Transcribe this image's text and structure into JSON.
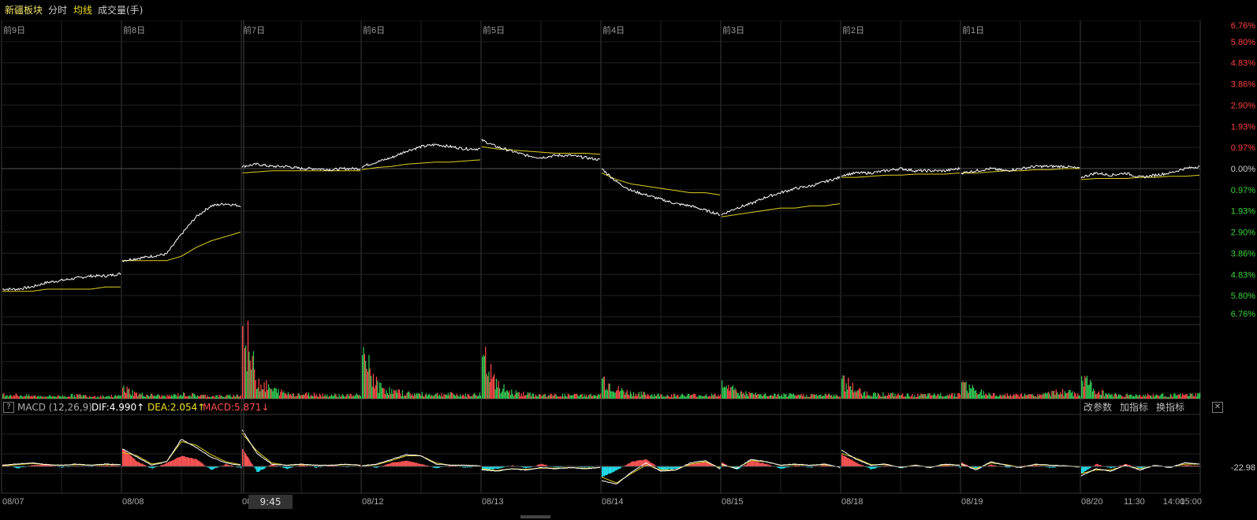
{
  "header": {
    "title": "新疆板块",
    "tab_intraday": "分时",
    "tab_avg": "均线",
    "tab_volume": "成交量(手)"
  },
  "price_axis": {
    "up_labels": [
      "6.76%",
      "5.80%",
      "4.83%",
      "3.86%",
      "2.90%",
      "1.93%",
      "0.97%"
    ],
    "zero_label": "0.00%",
    "down_labels": [
      "0.97%",
      "1.93%",
      "2.90%",
      "3.86%",
      "4.83%",
      "5.80%",
      "6.76%"
    ],
    "up_color": "#ff4040",
    "down_color": "#3cd43c"
  },
  "day_labels": [
    "前9日",
    "前8日",
    "前7日",
    "前6日",
    "前5日",
    "前4日",
    "前3日",
    "前2日",
    "前1日"
  ],
  "date_labels": [
    "08/07",
    "08/08",
    "08/08",
    "08/12",
    "08/13",
    "08/14",
    "08/15",
    "08/18",
    "08/19",
    "08/20"
  ],
  "time_labels": [
    "11:30",
    "14:00",
    "15:00"
  ],
  "crosshair_time": "9:45",
  "macd": {
    "help": "?",
    "name": "MACD (12,26,9)",
    "dif": "DIF:4.990↑",
    "dea": "DEA:2.054↑",
    "macd": "MACD:5.871↓",
    "value_right": "-22.98",
    "btn_params": "改参数",
    "btn_add": "加指标",
    "btn_switch": "换指标",
    "btn_close": "✕"
  },
  "colors": {
    "price_line": "#ffffff",
    "avg_line": "#e0d020",
    "dif": "#ffffff",
    "dea": "#e0d020",
    "up": "#ff5555",
    "down": "#22e0ee",
    "vol_up": "#ff4a4a",
    "vol_down": "#33cc55",
    "grid": "#2a2a2a"
  },
  "chart_data": {
    "type": "line",
    "days": 10,
    "price_pct": [
      [
        -5.5,
        -5.5,
        -5.4,
        -5.2,
        -5.1,
        -5.0,
        -4.9,
        -4.9,
        -4.8
      ],
      [
        -4.2,
        -4.1,
        -4.0,
        -3.9,
        -3.0,
        -2.2,
        -1.7,
        -1.6,
        -1.7
      ],
      [
        0.1,
        0.2,
        0.1,
        0.1,
        0.0,
        0.0,
        -0.05,
        0.0,
        0.0
      ],
      [
        0.1,
        0.3,
        0.5,
        0.8,
        1.0,
        1.1,
        1.0,
        0.9,
        0.9
      ],
      [
        1.3,
        1.0,
        0.8,
        0.6,
        0.5,
        0.6,
        0.6,
        0.5,
        0.4
      ],
      [
        0.0,
        -0.6,
        -1.0,
        -1.2,
        -1.4,
        -1.6,
        -1.7,
        -1.9,
        -2.1
      ],
      [
        -2.1,
        -1.8,
        -1.6,
        -1.3,
        -1.1,
        -0.9,
        -0.8,
        -0.6,
        -0.4
      ],
      [
        -0.3,
        -0.2,
        -0.2,
        -0.1,
        0.0,
        -0.1,
        -0.1,
        -0.1,
        0.0
      ],
      [
        -0.2,
        -0.1,
        0.0,
        -0.1,
        0.0,
        0.1,
        0.1,
        0.1,
        0.0
      ],
      [
        -0.4,
        -0.2,
        -0.3,
        -0.2,
        -0.4,
        -0.3,
        -0.2,
        0.0,
        0.1
      ]
    ],
    "avg_pct": [
      [
        -5.6,
        -5.6,
        -5.6,
        -5.5,
        -5.5,
        -5.5,
        -5.5,
        -5.4,
        -5.4
      ],
      [
        -4.2,
        -4.2,
        -4.2,
        -4.2,
        -4.0,
        -3.6,
        -3.3,
        -3.1,
        -2.9
      ],
      [
        -0.2,
        -0.15,
        -0.1,
        -0.1,
        -0.1,
        -0.1,
        -0.1,
        -0.1,
        -0.1
      ],
      [
        -0.05,
        0.05,
        0.1,
        0.2,
        0.25,
        0.3,
        0.3,
        0.35,
        0.4
      ],
      [
        1.0,
        0.9,
        0.85,
        0.8,
        0.75,
        0.7,
        0.7,
        0.7,
        0.65
      ],
      [
        -0.2,
        -0.5,
        -0.7,
        -0.8,
        -0.9,
        -1.0,
        -1.1,
        -1.1,
        -1.2
      ],
      [
        -2.2,
        -2.1,
        -2.0,
        -1.9,
        -1.8,
        -1.8,
        -1.7,
        -1.7,
        -1.6
      ],
      [
        -0.4,
        -0.4,
        -0.35,
        -0.3,
        -0.3,
        -0.25,
        -0.25,
        -0.25,
        -0.2
      ],
      [
        -0.2,
        -0.2,
        -0.15,
        -0.1,
        -0.1,
        -0.05,
        -0.05,
        0.0,
        0.0
      ],
      [
        -0.5,
        -0.45,
        -0.45,
        -0.45,
        -0.4,
        -0.4,
        -0.35,
        -0.35,
        -0.3
      ]
    ],
    "volume": [
      [
        5,
        4,
        3,
        3,
        3,
        4,
        3,
        3,
        3
      ],
      [
        12,
        5,
        4,
        3,
        5,
        4,
        3,
        3,
        4
      ],
      [
        80,
        20,
        10,
        6,
        5,
        5,
        4,
        4,
        4
      ],
      [
        48,
        15,
        8,
        6,
        5,
        5,
        5,
        4,
        5
      ],
      [
        46,
        14,
        7,
        5,
        4,
        4,
        4,
        4,
        4
      ],
      [
        22,
        10,
        6,
        5,
        4,
        4,
        4,
        4,
        4
      ],
      [
        20,
        8,
        5,
        4,
        4,
        4,
        4,
        4,
        4
      ],
      [
        22,
        9,
        5,
        5,
        4,
        4,
        4,
        5,
        5
      ],
      [
        18,
        8,
        5,
        4,
        4,
        4,
        6,
        8,
        4
      ],
      [
        25,
        8,
        5,
        4,
        4,
        4,
        4,
        4,
        5
      ]
    ],
    "macd_hist": [
      [
        4,
        -3,
        2,
        4,
        -2,
        1,
        -1,
        2,
        1
      ],
      [
        30,
        8,
        -4,
        6,
        18,
        12,
        -6,
        4,
        -3
      ],
      [
        30,
        -10,
        4,
        -4,
        3,
        -2,
        2,
        -1,
        1
      ],
      [
        2,
        -2,
        6,
        10,
        4,
        -3,
        2,
        -2,
        1
      ],
      [
        -6,
        -4,
        2,
        -3,
        4,
        -2,
        1,
        -2,
        1
      ],
      [
        -18,
        -6,
        8,
        12,
        -6,
        -4,
        4,
        8,
        -3
      ],
      [
        6,
        -6,
        10,
        4,
        -4,
        2,
        -2,
        3,
        -2
      ],
      [
        20,
        6,
        -5,
        2,
        -3,
        2,
        -2,
        3,
        -2
      ],
      [
        6,
        -4,
        3,
        -2,
        1,
        2,
        -2,
        1,
        -1
      ],
      [
        -12,
        4,
        -3,
        4,
        -3,
        2,
        -2,
        2,
        1
      ]
    ],
    "dif": [
      [
        2,
        4,
        6,
        3,
        2,
        4,
        2,
        4,
        3
      ],
      [
        30,
        16,
        2,
        8,
        46,
        32,
        16,
        6,
        2
      ],
      [
        62,
        22,
        4,
        2,
        4,
        2,
        2,
        4,
        2
      ],
      [
        1,
        4,
        12,
        20,
        18,
        4,
        2,
        2,
        1
      ],
      [
        -6,
        -8,
        -4,
        -6,
        -2,
        -4,
        -2,
        -4,
        -2
      ],
      [
        -24,
        -30,
        -10,
        6,
        -8,
        -6,
        6,
        10,
        -4
      ],
      [
        4,
        -4,
        12,
        8,
        2,
        4,
        2,
        4,
        -2
      ],
      [
        28,
        12,
        2,
        4,
        -2,
        2,
        -2,
        4,
        2
      ],
      [
        4,
        -6,
        8,
        2,
        -2,
        4,
        2,
        1,
        -1
      ],
      [
        -16,
        -4,
        -8,
        2,
        -6,
        2,
        -2,
        6,
        4
      ]
    ],
    "dea": [
      [
        1,
        3,
        5,
        3,
        2,
        3,
        2,
        3,
        3
      ],
      [
        24,
        18,
        4,
        8,
        42,
        36,
        20,
        8,
        3
      ],
      [
        56,
        26,
        6,
        2,
        3,
        2,
        2,
        3,
        2
      ],
      [
        1,
        3,
        10,
        18,
        18,
        6,
        2,
        2,
        1
      ],
      [
        -4,
        -7,
        -4,
        -5,
        -3,
        -3,
        -2,
        -3,
        -2
      ],
      [
        -18,
        -28,
        -12,
        2,
        -6,
        -6,
        4,
        8,
        -2
      ],
      [
        2,
        -3,
        10,
        8,
        2,
        3,
        2,
        3,
        -1
      ],
      [
        22,
        14,
        3,
        3,
        -1,
        2,
        -1,
        3,
        2
      ],
      [
        3,
        -4,
        6,
        3,
        -1,
        3,
        2,
        1,
        0
      ],
      [
        -12,
        -6,
        -6,
        1,
        -4,
        1,
        -1,
        4,
        4
      ]
    ]
  }
}
